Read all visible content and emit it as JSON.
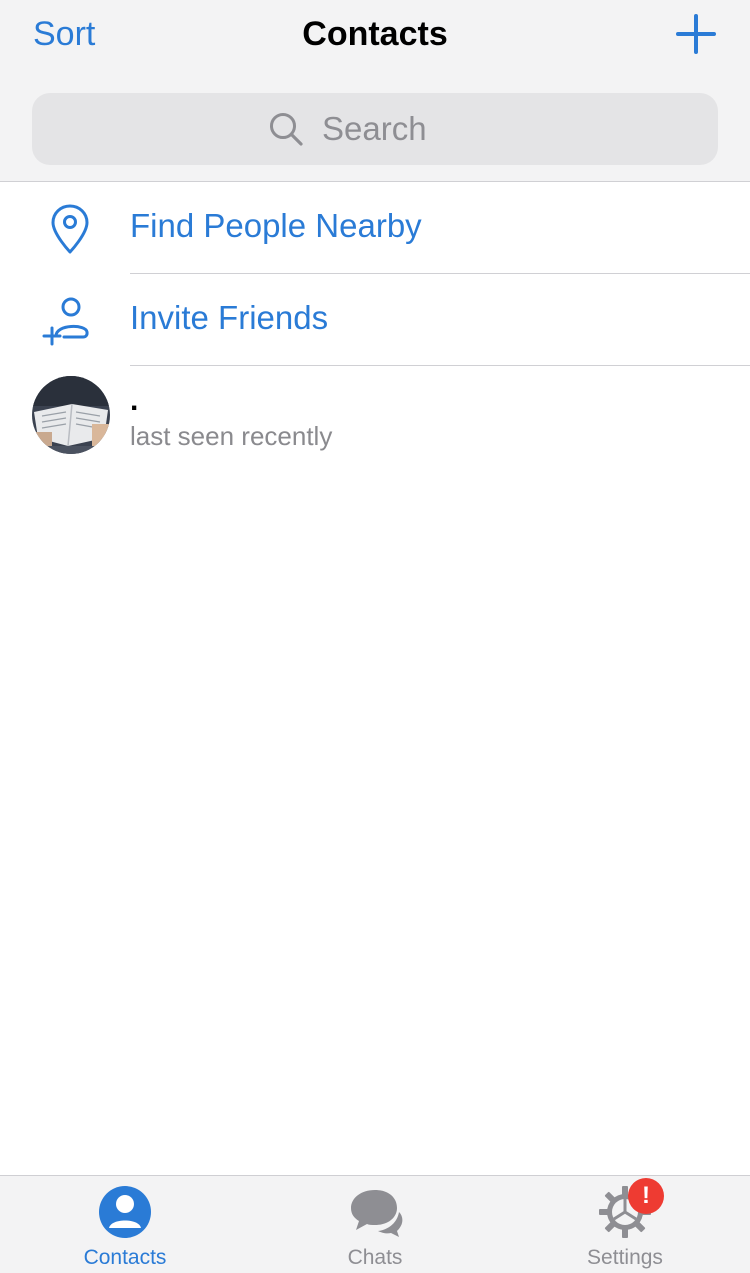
{
  "nav": {
    "sort_label": "Sort",
    "title": "Contacts",
    "add_icon": "plus-icon"
  },
  "search": {
    "placeholder": "Search",
    "icon": "search-icon"
  },
  "actions": [
    {
      "label": "Find People Nearby",
      "icon": "location-pin-icon"
    },
    {
      "label": "Invite Friends",
      "icon": "add-person-icon"
    }
  ],
  "contacts": [
    {
      "name": ".",
      "status": "last seen recently",
      "avatar": "photo-avatar"
    }
  ],
  "tabs": [
    {
      "label": "Contacts",
      "icon": "person-icon",
      "active": true
    },
    {
      "label": "Chats",
      "icon": "chat-bubbles-icon",
      "active": false
    },
    {
      "label": "Settings",
      "icon": "gear-icon",
      "active": false,
      "badge": "!"
    }
  ],
  "colors": {
    "accent": "#2a7bd6",
    "badge": "#ee3b32",
    "inactive": "#8e8e93"
  }
}
